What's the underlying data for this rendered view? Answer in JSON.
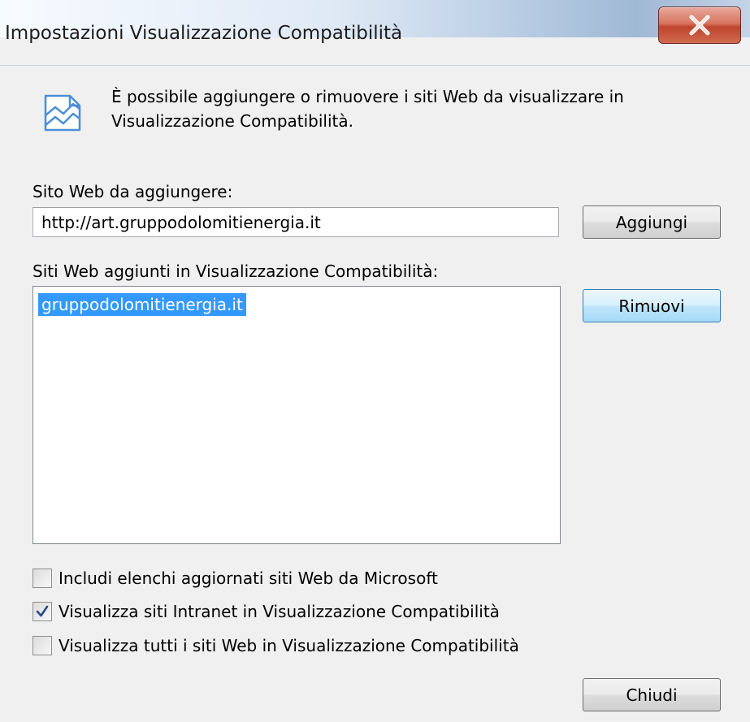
{
  "window": {
    "title": "Impostazioni Visualizzazione Compatibilità",
    "close_glyph": "X"
  },
  "info": {
    "icon": "compatibility-view-icon",
    "text": "È possibile aggiungere o rimuovere i siti Web da visualizzare in Visualizzazione Compatibilità."
  },
  "add_section": {
    "label": "Sito Web da aggiungere:",
    "input_value": "http://art.gruppodolomitienergia.it",
    "add_button": "Aggiungi"
  },
  "list_section": {
    "label": "Siti Web aggiunti in Visualizzazione Compatibilità:",
    "items": [
      "gruppodolomitienergia.it"
    ],
    "selected_index": 0,
    "remove_button": "Rimuovi"
  },
  "options": [
    {
      "label": "Includi elenchi aggiornati siti Web da Microsoft",
      "checked": false
    },
    {
      "label": "Visualizza siti Intranet in Visualizzazione Compatibilità",
      "checked": true
    },
    {
      "label": "Visualizza tutti i siti Web in Visualizzazione Compatibilità",
      "checked": false
    }
  ],
  "footer": {
    "close_button": "Chiudi"
  },
  "colors": {
    "selection": "#3399ff",
    "close_button_red": "#c0432d",
    "icon_blue": "#4a8fd6"
  }
}
